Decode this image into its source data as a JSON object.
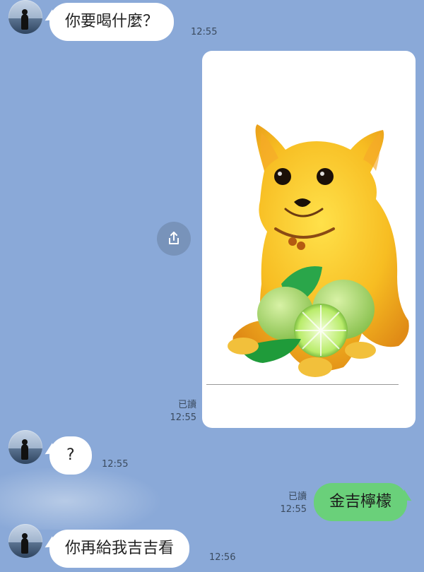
{
  "messages": [
    {
      "side": "in",
      "text": "你要喝什麼？",
      "time": "12:55"
    },
    {
      "side": "out",
      "type": "image",
      "image_desc": "yellow chihuahua with limes",
      "read": "已讀",
      "time": "12:55"
    },
    {
      "side": "in",
      "text": "?",
      "time": "12:55"
    },
    {
      "side": "out",
      "text": "金吉檸檬",
      "read": "已讀",
      "time": "12:55"
    },
    {
      "side": "in",
      "text": "你再給我吉吉看",
      "time": "12:56"
    }
  ],
  "colors": {
    "background": "#8aa9d8",
    "incoming_bubble": "#ffffff",
    "outgoing_bubble": "#6ad07a",
    "timestamp": "#3b4b5f"
  },
  "icons": {
    "share": "share-icon"
  }
}
